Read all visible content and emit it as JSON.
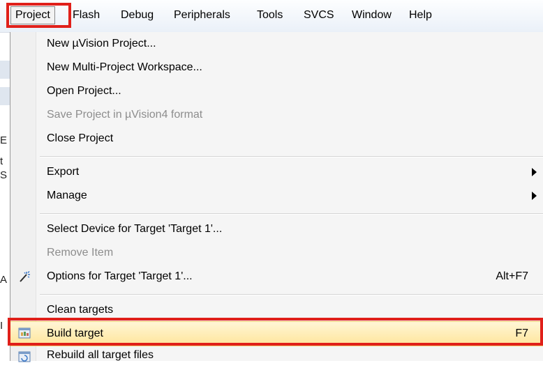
{
  "menubar": {
    "items": [
      "Project",
      "Flash",
      "Debug",
      "Peripherals",
      "Tools",
      "SVCS",
      "Window",
      "Help"
    ]
  },
  "background_fragments": [
    "E",
    "t",
    "S",
    "A",
    "I"
  ],
  "project_menu": {
    "items": [
      {
        "label": "New µVision Project...",
        "enabled": true
      },
      {
        "label": "New Multi-Project Workspace...",
        "enabled": true
      },
      {
        "label": "Open Project...",
        "enabled": true
      },
      {
        "label": "Save Project in µVision4 format",
        "enabled": false
      },
      {
        "label": "Close Project",
        "enabled": true
      },
      {
        "label": "Export",
        "enabled": true,
        "submenu": true
      },
      {
        "label": "Manage",
        "enabled": true,
        "submenu": true
      },
      {
        "label": "Select Device for Target 'Target 1'...",
        "enabled": true
      },
      {
        "label": "Remove Item",
        "enabled": false
      },
      {
        "label": "Options for Target 'Target 1'...",
        "enabled": true,
        "shortcut": "Alt+F7",
        "icon": "magic-wand-icon"
      },
      {
        "label": "Clean targets",
        "enabled": true
      },
      {
        "label": "Build target",
        "enabled": true,
        "shortcut": "F7",
        "icon": "build-target-icon",
        "highlighted": true
      },
      {
        "label": "Rebuild all target files",
        "enabled": true,
        "icon": "rebuild-all-icon"
      }
    ]
  },
  "colors": {
    "annotation_red": "#e0201a",
    "highlight": "#ffe59a",
    "disabled_text": "#8d8d8d"
  }
}
